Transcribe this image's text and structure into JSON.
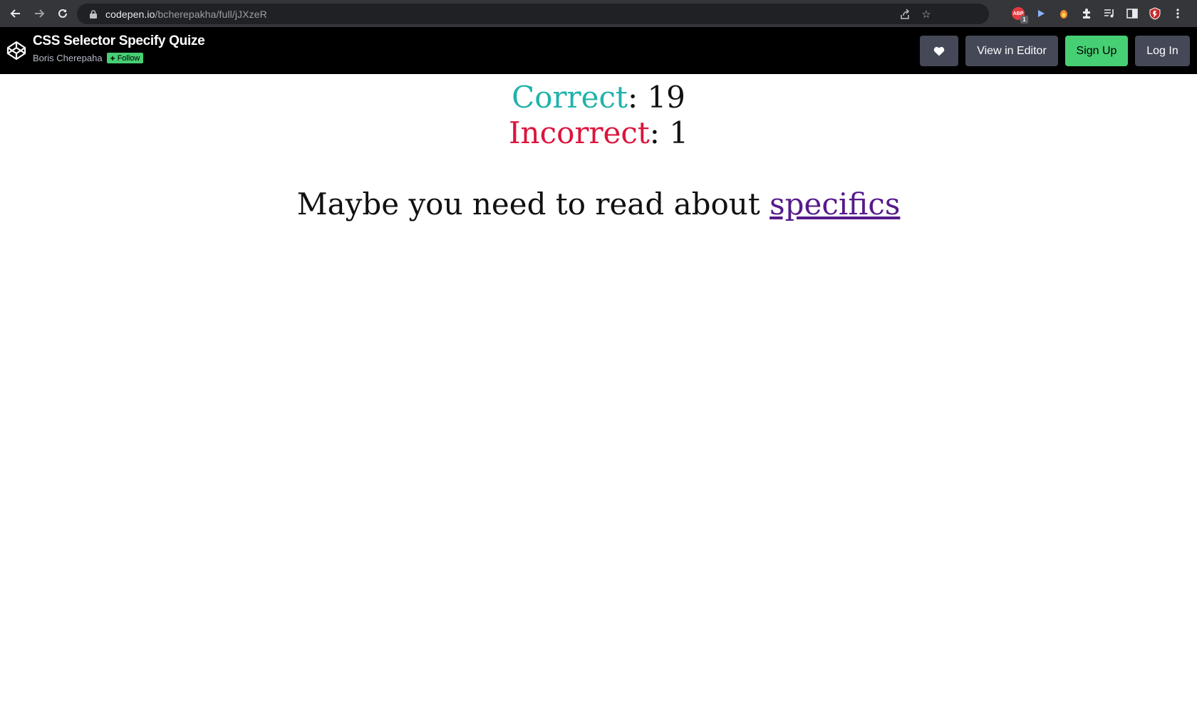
{
  "browser": {
    "url_host": "codepen.io",
    "url_path": "/bcherepakha/full/jJXzeR",
    "extensions": [
      "adblock-icon",
      "play-extension-icon",
      "orange-extension-icon",
      "puzzle-extensions-icon",
      "media-queue-icon",
      "side-panel-icon",
      "shield-extension-icon"
    ],
    "adblock_badge": "1",
    "adblock_label": "ABP"
  },
  "header": {
    "title": "CSS Selector Specify Quize",
    "author": "Boris Cherepaha",
    "follow_label": "Follow",
    "view_editor_label": "View in Editor",
    "signup_label": "Sign Up",
    "login_label": "Log In",
    "colors": {
      "bar": "#000000",
      "button": "#444857",
      "green": "#47cf73"
    }
  },
  "results": {
    "correct_label": "Correct",
    "correct_count": "19",
    "incorrect_label": "Incorrect",
    "incorrect_count": "1",
    "separator": ": ",
    "hint_text": "Maybe you need to read about ",
    "hint_link": "specifics",
    "colors": {
      "correct": "#20b2aa",
      "incorrect": "#dc143c",
      "link": "#551a8b"
    }
  }
}
